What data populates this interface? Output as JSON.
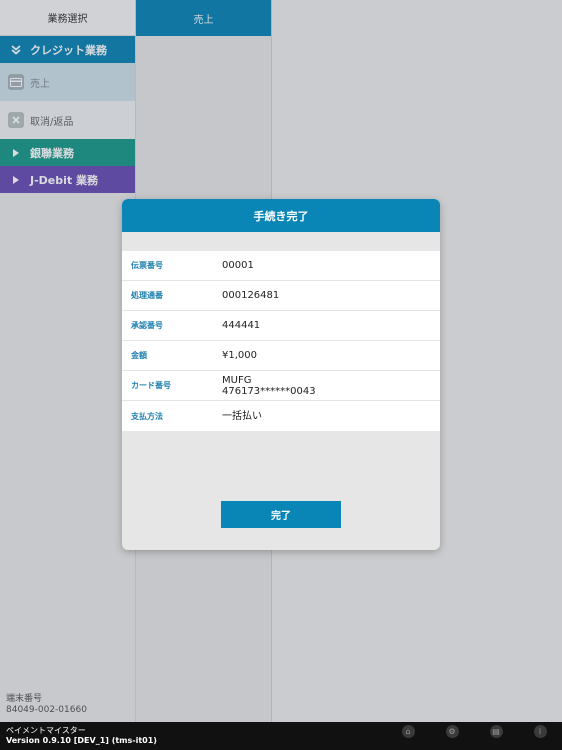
{
  "sidebar": {
    "title": "業務選択",
    "categories": {
      "credit": "クレジット業務",
      "unionpay": "銀聯業務",
      "jdebit": "J-Debit 業務"
    },
    "items": {
      "sales": "売上",
      "cancel": "取消/返品"
    },
    "terminal_label": "端末番号",
    "terminal_number": "84049-002-01660"
  },
  "column2": {
    "header": "売上"
  },
  "modal": {
    "title": "手続き完了",
    "rows": [
      {
        "label": "伝票番号",
        "value": "00001"
      },
      {
        "label": "処理通番",
        "value": "000126481"
      },
      {
        "label": "承認番号",
        "value": "444441"
      },
      {
        "label": "金額",
        "value": "¥1,000"
      },
      {
        "label": "カード番号",
        "value": "MUFG",
        "value2": "476173******0043"
      },
      {
        "label": "支払方法",
        "value": "一括払い"
      }
    ],
    "done_button": "完了"
  },
  "bottombar": {
    "app_name": "ペイメントマイスター",
    "version": "Version 0.9.10 [DEV_1] (tms-it01)",
    "icons": [
      "home-icon",
      "settings-icon",
      "history-icon",
      "info-icon"
    ]
  },
  "colors": {
    "accent": "#0a86b6",
    "unionpay": "#1a9a8a",
    "jdebit": "#6a4fb5"
  }
}
